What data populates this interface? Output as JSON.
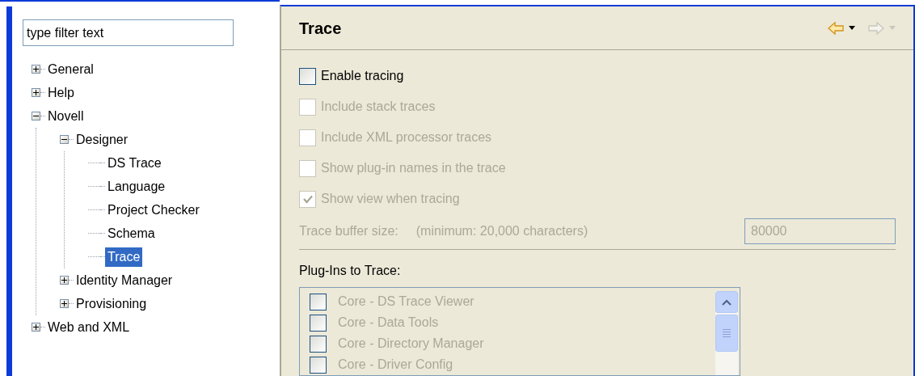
{
  "filter": {
    "placeholder": "type filter text"
  },
  "tree": [
    {
      "label": "General",
      "expanded": false,
      "selected": false
    },
    {
      "label": "Help",
      "expanded": false,
      "selected": false
    },
    {
      "label": "Novell",
      "expanded": true,
      "selected": false,
      "children": [
        {
          "label": "Designer",
          "expanded": true,
          "selected": false,
          "children": [
            {
              "label": "DS Trace",
              "selected": false
            },
            {
              "label": "Language",
              "selected": false
            },
            {
              "label": "Project Checker",
              "selected": false
            },
            {
              "label": "Schema",
              "selected": false
            },
            {
              "label": "Trace",
              "selected": true
            }
          ]
        },
        {
          "label": "Identity Manager",
          "expanded": false,
          "selected": false
        },
        {
          "label": "Provisioning",
          "expanded": false,
          "selected": false
        }
      ]
    },
    {
      "label": "Web and XML",
      "expanded": false,
      "selected": false
    }
  ],
  "page": {
    "title": "Trace",
    "nav": {
      "back": {
        "disabled": false
      },
      "forward": {
        "disabled": true
      }
    }
  },
  "options": [
    {
      "label": "Enable tracing",
      "checked": false,
      "disabled": false
    },
    {
      "label": "Include stack traces",
      "checked": false,
      "disabled": true
    },
    {
      "label": "Include XML processor traces",
      "checked": false,
      "disabled": true
    },
    {
      "label": "Show plug-in names in the trace",
      "checked": false,
      "disabled": true
    },
    {
      "label": "Show view when tracing",
      "checked": true,
      "disabled": true
    }
  ],
  "buffer": {
    "label": "Trace buffer size:",
    "hint": "(minimum: 20,000 characters)",
    "value": "80000",
    "disabled": true
  },
  "plugins": {
    "label": "Plug-Ins to Trace:",
    "disabled": true,
    "items": [
      {
        "label": "Core - DS Trace Viewer",
        "checked": false
      },
      {
        "label": "Core - Data Tools",
        "checked": false
      },
      {
        "label": "Core - Directory Manager",
        "checked": false
      },
      {
        "label": "Core - Driver Config",
        "checked": false
      }
    ]
  }
}
